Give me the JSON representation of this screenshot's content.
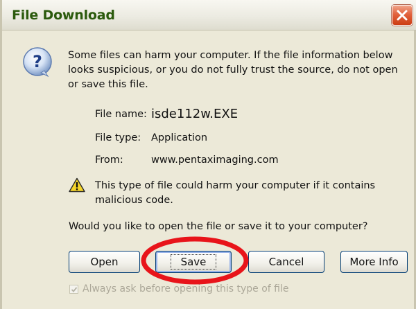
{
  "window": {
    "title": "File Download"
  },
  "message": "Some files can harm your computer. If the file information below looks suspicious, or you do not fully trust the source, do not open or save this file.",
  "file_info": {
    "name_label": "File name:",
    "name_value": "isde112w.EXE",
    "type_label": "File type:",
    "type_value": "Application",
    "from_label": "From:",
    "from_value": "www.pentaximaging.com"
  },
  "warning": "This type of file could harm your computer if it contains malicious code.",
  "question": "Would you like to open the file or save it to your computer?",
  "buttons": {
    "open": "Open",
    "save": "Save",
    "cancel": "Cancel",
    "more_info": "More Info"
  },
  "checkbox": {
    "label": "Always ask before opening this type of file",
    "checked": true,
    "enabled": false
  },
  "colors": {
    "title_text": "#2b5a0d",
    "close_button": "#e2623d",
    "highlight": "#e8141a",
    "dialog_bg": "#ece9d8"
  },
  "icons": {
    "info": "question-mark-icon",
    "warning": "warning-triangle-icon",
    "close": "close-icon"
  }
}
